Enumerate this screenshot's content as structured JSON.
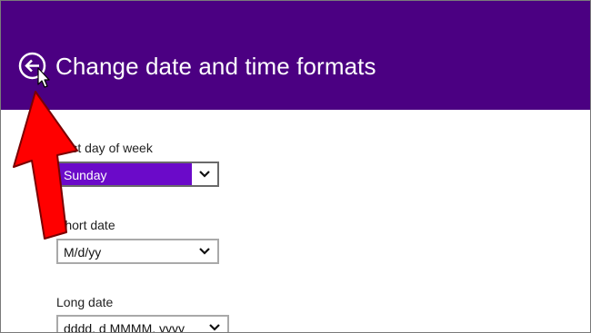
{
  "colors": {
    "header_bg": "#4b0082",
    "accent": "#6b0ac9",
    "white": "#ffffff",
    "annotation_red": "#ff0000",
    "border": "#a9a9a9"
  },
  "header": {
    "back_icon": "back-arrow-circle-icon",
    "title": "Change date and time formats"
  },
  "fields": {
    "first_day_of_week": {
      "label": "First day of week",
      "value": "Sunday"
    },
    "short_date": {
      "label": "Short date",
      "value": "M/d/yy"
    },
    "long_date": {
      "label": "Long date",
      "value": "dddd, d MMMM, yyyy"
    }
  },
  "icons": {
    "dropdown": "chevron-down-icon",
    "annotation": "red-arrow-annotation",
    "cursor": "mouse-pointer-icon"
  }
}
